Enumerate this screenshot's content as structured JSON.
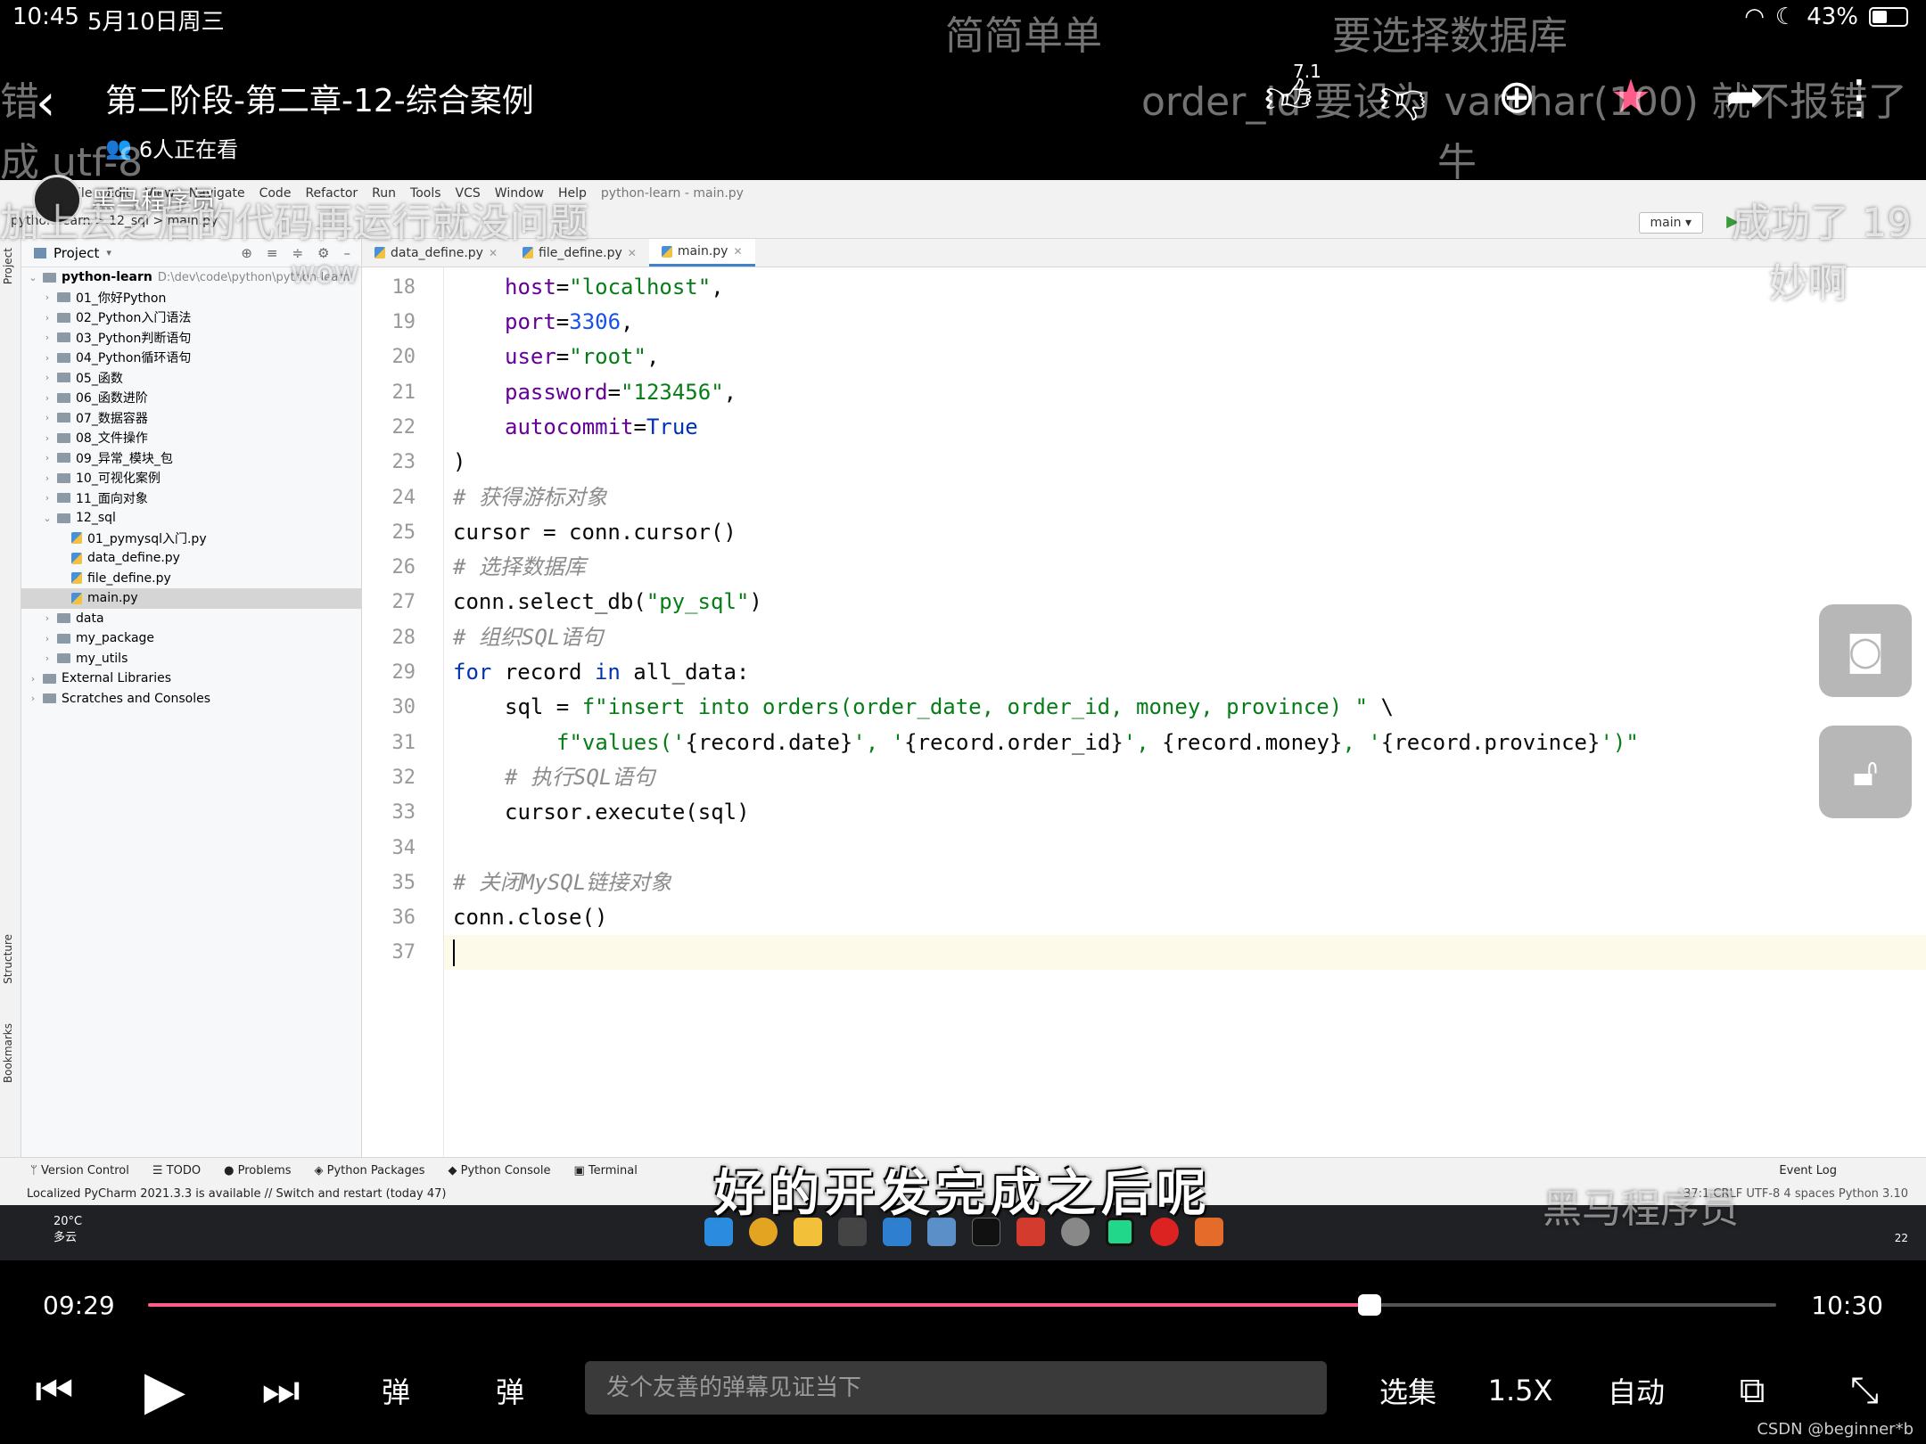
{
  "status_bar": {
    "time": "10:45",
    "date": "5月10日周三",
    "battery": "43%"
  },
  "header": {
    "title": "第二阶段-第二章-12-综合案例",
    "viewers": "6人正在看",
    "like_count": "7.1万"
  },
  "danmaku": [
    "简简单单",
    "要选择数据库",
    "错",
    "成 utf-8",
    "order_id 要设为 varchar(100) 就不报错了",
    "牛",
    "加上去之后的代码再运行就没问题",
    "wow",
    "成功了 19",
    "妙啊",
    "黑马程序员"
  ],
  "channel_badge": "黑马程序员",
  "ide": {
    "menu": [
      "File",
      "Edit",
      "View",
      "Navigate",
      "Code",
      "Refactor",
      "Run",
      "Tools",
      "VCS",
      "Window",
      "Help",
      "python-learn - main.py"
    ],
    "breadcrumb": "python-learn > 12_sql > main.py",
    "run_config": "main",
    "project_label": "Project",
    "left_strip": [
      "Project",
      "Structure",
      "Bookmarks"
    ],
    "tree": [
      {
        "label": "python-learn",
        "type": "root",
        "path": "D:\\dev\\code\\python\\python-learn"
      },
      {
        "label": "01_你好Python",
        "type": "folder"
      },
      {
        "label": "02_Python入门语法",
        "type": "folder"
      },
      {
        "label": "03_Python判断语句",
        "type": "folder"
      },
      {
        "label": "04_Python循环语句",
        "type": "folder"
      },
      {
        "label": "05_函数",
        "type": "folder"
      },
      {
        "label": "06_函数进阶",
        "type": "folder"
      },
      {
        "label": "07_数据容器",
        "type": "folder"
      },
      {
        "label": "08_文件操作",
        "type": "folder"
      },
      {
        "label": "09_异常_模块_包",
        "type": "folder"
      },
      {
        "label": "10_可视化案例",
        "type": "folder"
      },
      {
        "label": "11_面向对象",
        "type": "folder"
      },
      {
        "label": "12_sql",
        "type": "open-folder"
      },
      {
        "label": "01_pymysql入门.py",
        "type": "file"
      },
      {
        "label": "data_define.py",
        "type": "file"
      },
      {
        "label": "file_define.py",
        "type": "file"
      },
      {
        "label": "main.py",
        "type": "file",
        "selected": true
      },
      {
        "label": "data",
        "type": "folder"
      },
      {
        "label": "my_package",
        "type": "folder"
      },
      {
        "label": "my_utils",
        "type": "folder"
      },
      {
        "label": "External Libraries",
        "type": "lib"
      },
      {
        "label": "Scratches and Consoles",
        "type": "lib"
      }
    ],
    "tabs": [
      "data_define.py",
      "file_define.py",
      "main.py"
    ],
    "active_tab": "main.py",
    "code_lines": [
      {
        "n": "18",
        "indent": 1,
        "tokens": [
          [
            "param",
            "host"
          ],
          [
            "p",
            "="
          ],
          [
            "str",
            "\"localhost\""
          ],
          [
            "p",
            ","
          ]
        ]
      },
      {
        "n": "19",
        "indent": 1,
        "tokens": [
          [
            "param",
            "port"
          ],
          [
            "p",
            "="
          ],
          [
            "num",
            "3306"
          ],
          [
            "p",
            ","
          ]
        ]
      },
      {
        "n": "20",
        "indent": 1,
        "tokens": [
          [
            "param",
            "user"
          ],
          [
            "p",
            "="
          ],
          [
            "str",
            "\"root\""
          ],
          [
            "p",
            ","
          ]
        ]
      },
      {
        "n": "21",
        "indent": 1,
        "tokens": [
          [
            "param",
            "password"
          ],
          [
            "p",
            "="
          ],
          [
            "str",
            "\"123456\""
          ],
          [
            "p",
            ","
          ]
        ]
      },
      {
        "n": "22",
        "indent": 1,
        "tokens": [
          [
            "param",
            "autocommit"
          ],
          [
            "p",
            "="
          ],
          [
            "kw",
            "True"
          ]
        ]
      },
      {
        "n": "23",
        "indent": 0,
        "tokens": [
          [
            "p",
            ")"
          ]
        ]
      },
      {
        "n": "24",
        "indent": 0,
        "tokens": [
          [
            "cm",
            "# 获得游标对象"
          ]
        ]
      },
      {
        "n": "25",
        "indent": 0,
        "tokens": [
          [
            "p",
            "cursor = conn.cursor()"
          ]
        ]
      },
      {
        "n": "26",
        "indent": 0,
        "tokens": [
          [
            "cm",
            "# 选择数据库"
          ]
        ]
      },
      {
        "n": "27",
        "indent": 0,
        "tokens": [
          [
            "p",
            "conn.select_db("
          ],
          [
            "str",
            "\"py_sql\""
          ],
          [
            "p",
            ")"
          ]
        ]
      },
      {
        "n": "28",
        "indent": 0,
        "tokens": [
          [
            "cm",
            "# 组织SQL语句"
          ]
        ]
      },
      {
        "n": "29",
        "indent": 0,
        "tokens": [
          [
            "kw",
            "for"
          ],
          [
            "p",
            " record "
          ],
          [
            "kw",
            "in"
          ],
          [
            "p",
            " all_data:"
          ]
        ]
      },
      {
        "n": "30",
        "indent": 1,
        "tokens": [
          [
            "p",
            "sql = "
          ],
          [
            "str",
            "f\"insert into orders(order_date, order_id, money, province) \""
          ],
          [
            "p",
            " \\"
          ]
        ]
      },
      {
        "n": "31",
        "indent": 2,
        "tokens": [
          [
            "str",
            "f\"values('"
          ],
          [
            "p",
            "{record.date}"
          ],
          [
            "str",
            "', '"
          ],
          [
            "p",
            "{record.order_id}"
          ],
          [
            "str",
            "', "
          ],
          [
            "p",
            "{record.money}"
          ],
          [
            "str",
            ", '"
          ],
          [
            "p",
            "{record.province}"
          ],
          [
            "str",
            "')\""
          ]
        ]
      },
      {
        "n": "32",
        "indent": 1,
        "tokens": [
          [
            "cm",
            "# 执行SQL语句"
          ]
        ]
      },
      {
        "n": "33",
        "indent": 1,
        "tokens": [
          [
            "p",
            "cursor.execute(sql)"
          ]
        ]
      },
      {
        "n": "34",
        "indent": 0,
        "tokens": []
      },
      {
        "n": "35",
        "indent": 0,
        "tokens": [
          [
            "cm",
            "# 关闭MySQL链接对象"
          ]
        ]
      },
      {
        "n": "36",
        "indent": 0,
        "tokens": [
          [
            "p",
            "conn.close()"
          ]
        ]
      },
      {
        "n": "37",
        "indent": 0,
        "tokens": [],
        "current": true
      }
    ],
    "tool_windows": [
      "Version Control",
      "TODO",
      "Problems",
      "Python Packages",
      "Python Console",
      "Terminal"
    ],
    "event_log": "Event Log",
    "status_message": "Localized PyCharm 2021.3.3 is available // Switch and restart (today 47)",
    "status_right": "37:1  CRLF  UTF-8  4 spaces  Python 3.10",
    "weather": {
      "temp": "20°C",
      "desc": "多云"
    },
    "taskbar_number": "22"
  },
  "subtitle": "好的开发完成之后呢",
  "player": {
    "current_time": "09:29",
    "total_time": "10:30",
    "progress": 0.75,
    "danmaku_placeholder": "发个友善的弹幕见证当下",
    "episodes": "选集",
    "speed": "1.5X",
    "quality": "自动"
  },
  "watermark": "CSDN @beginner*b",
  "colors": {
    "progress": "#ff5c8a",
    "favorite": "#ff5c8a",
    "keyword": "#0033b3",
    "string": "#067d17",
    "number": "#1750eb",
    "param": "#660099",
    "comment": "#8c8c8c"
  }
}
